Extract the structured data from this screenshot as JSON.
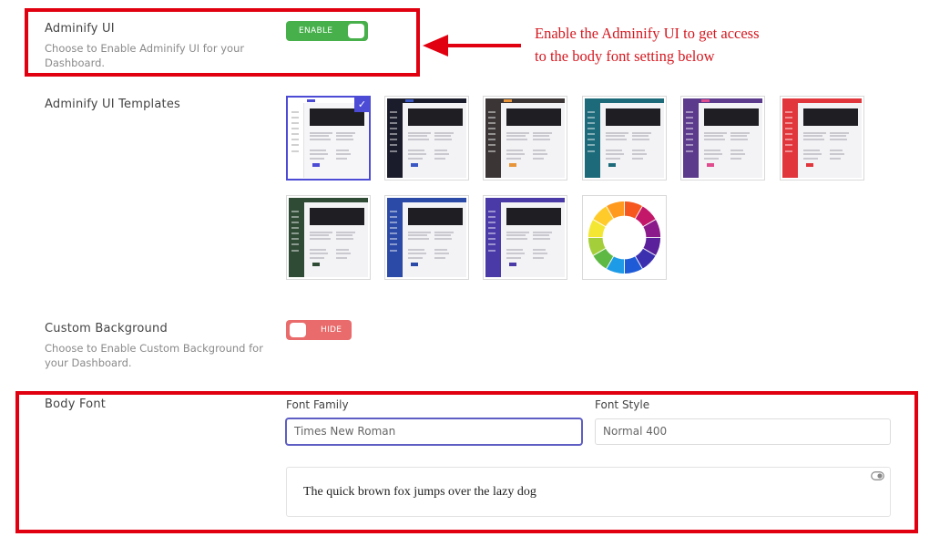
{
  "adminify_ui": {
    "title": "Adminify UI",
    "description_line1": "Choose to Enable Adminify UI for your",
    "description_line2": "Dashboard.",
    "toggle_label": "ENABLE"
  },
  "annotation": {
    "line1": "Enable the Adminify UI to get access",
    "line2": "to the body font setting below",
    "color": "#d51820"
  },
  "templates": {
    "title": "Adminify UI Templates",
    "selected_index": 0,
    "items": [
      {
        "name": "template-light",
        "sidebar": "#ffffff",
        "topbar": "#4b4bd6",
        "content": "#f6f6f8"
      },
      {
        "name": "template-dark-navy",
        "sidebar": "#1b1c2b",
        "topbar": "#3a57c4",
        "content": "#f3f3f6"
      },
      {
        "name": "template-dark-brown",
        "sidebar": "#3b3536",
        "topbar": "#e8953a",
        "content": "#f3f3f6"
      },
      {
        "name": "template-teal",
        "sidebar": "#1d6b7a",
        "topbar": "#1d6b7a",
        "content": "#f3f3f6"
      },
      {
        "name": "template-purple",
        "sidebar": "#5c3a8c",
        "topbar": "#e04c8d",
        "content": "#f3f3f6"
      },
      {
        "name": "template-red",
        "sidebar": "#e0363c",
        "topbar": "#e0363c",
        "content": "#f3f3f6"
      },
      {
        "name": "template-forest-green",
        "sidebar": "#2f4a35",
        "topbar": "#2f4a35",
        "content": "#f3f3f6"
      },
      {
        "name": "template-royal-blue",
        "sidebar": "#2b49a6",
        "topbar": "#2b49a6",
        "content": "#f3f3f6"
      },
      {
        "name": "template-indigo",
        "sidebar": "#4a3aa8",
        "topbar": "#4a3aa8",
        "content": "#f3f3f6"
      }
    ],
    "custom_icon": "color-wheel-icon",
    "wheel_colors": [
      "#f5571f",
      "#c3176a",
      "#8b1a8a",
      "#5a1f9a",
      "#3b2fb0",
      "#1f5bd6",
      "#1e9be6",
      "#5db944",
      "#a5cf3a",
      "#f3e734",
      "#ffcb2a",
      "#ff9a1f"
    ]
  },
  "custom_background": {
    "title": "Custom Background",
    "description_line1": "Choose to Enable Custom Background for",
    "description_line2": "your Dashboard.",
    "toggle_label": "HIDE"
  },
  "body_font": {
    "title": "Body Font",
    "font_family_label": "Font Family",
    "font_family_value": "Times New Roman",
    "font_style_label": "Font Style",
    "font_style_value": "Normal 400",
    "preview_text": "The quick brown fox jumps over the lazy dog",
    "preview_icon": "toggle-preview-icon"
  }
}
